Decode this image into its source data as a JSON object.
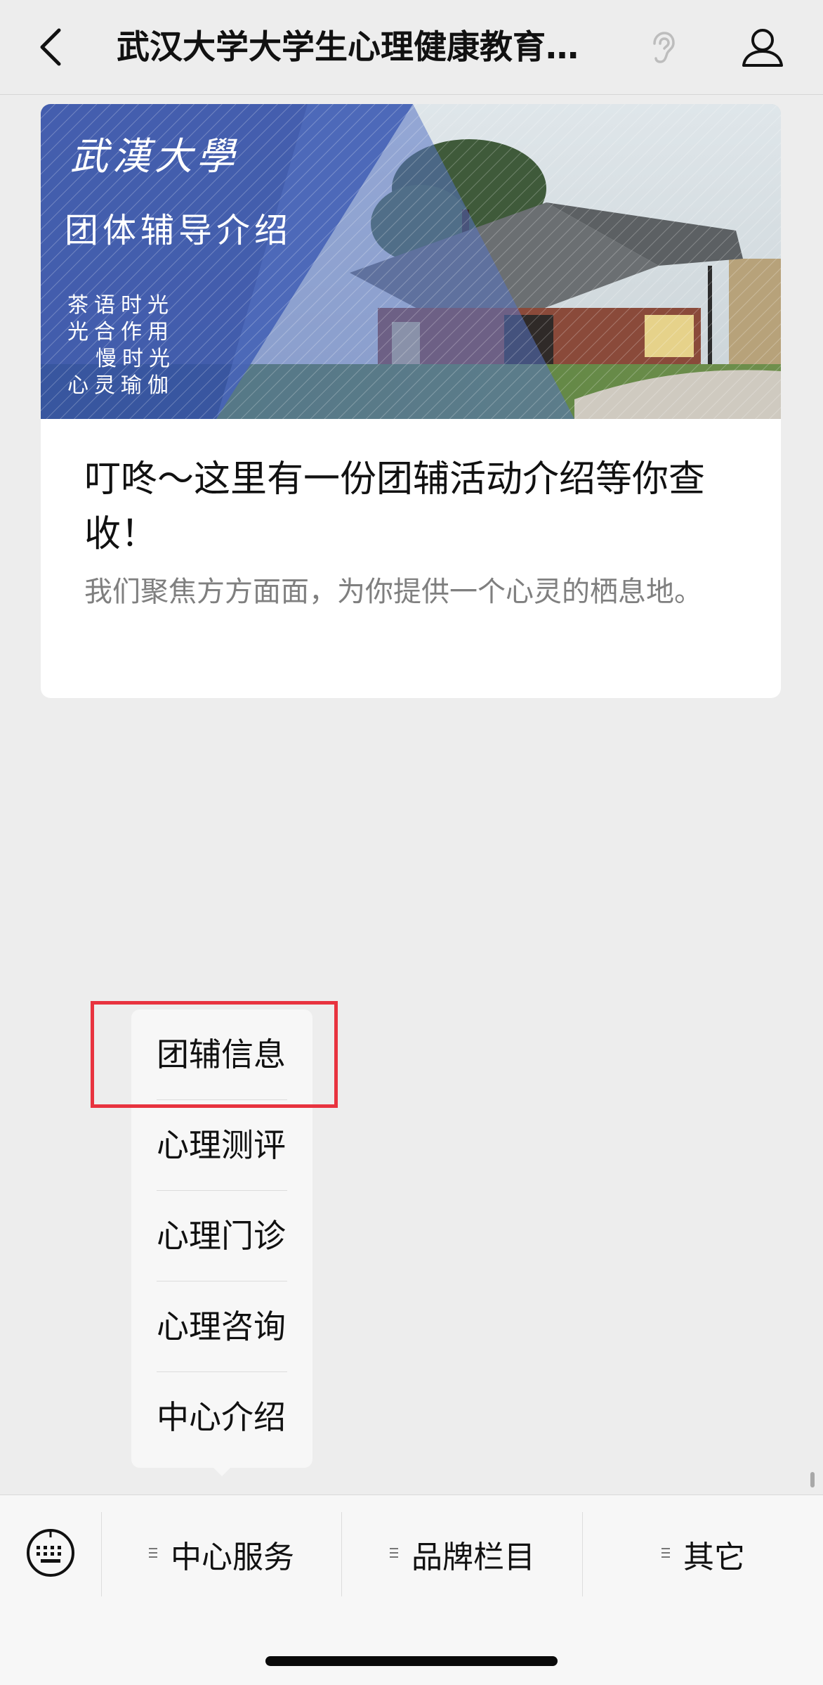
{
  "navbar": {
    "title": "武汉大学大学生心理健康教育…",
    "back_icon": "chevron-left-icon",
    "listen_icon": "ear-icon",
    "profile_icon": "person-icon"
  },
  "card": {
    "cover": {
      "line1": "武漢大學",
      "line2": "团体辅导介绍",
      "line3": [
        "茶语时光",
        "光合作用",
        "慢时光",
        "心灵瑜伽"
      ]
    },
    "title": "叮咚～这里有一份团辅活动介绍等你查收！",
    "summary": "我们聚焦方方面面，为你提供一个心灵的栖息地。"
  },
  "submenu": {
    "items": [
      {
        "label": "团辅信息",
        "highlighted": true
      },
      {
        "label": "心理测评",
        "highlighted": false
      },
      {
        "label": "心理门诊",
        "highlighted": false
      },
      {
        "label": "心理咨询",
        "highlighted": false
      },
      {
        "label": "中心介绍",
        "highlighted": false
      }
    ],
    "highlight_color": "#e8333f"
  },
  "menubar": {
    "keyboard_icon": "keyboard-icon",
    "tabs": [
      {
        "label": "中心服务",
        "icon": "lines-icon"
      },
      {
        "label": "品牌栏目",
        "icon": "lines-icon"
      },
      {
        "label": "其它",
        "icon": "lines-icon"
      }
    ]
  },
  "colors": {
    "background": "#ededed",
    "card": "#ffffff",
    "summary_text": "#7f7f7f",
    "menubar": "#f7f7f7"
  }
}
